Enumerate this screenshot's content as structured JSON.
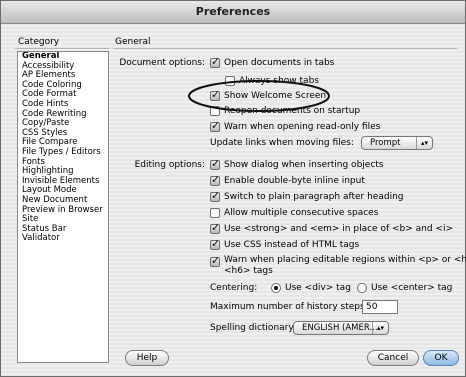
{
  "window": {
    "title": "Preferences"
  },
  "category": {
    "header": "Category",
    "items": [
      "General",
      "Accessibility",
      "AP Elements",
      "Code Coloring",
      "Code Format",
      "Code Hints",
      "Code Rewriting",
      "Copy/Paste",
      "CSS Styles",
      "File Compare",
      "File Types / Editors",
      "Fonts",
      "Highlighting",
      "Invisible Elements",
      "Layout Mode",
      "New Document",
      "Preview in Browser",
      "Site",
      "Status Bar",
      "Validator"
    ],
    "selected": "General"
  },
  "panel": {
    "header": "General"
  },
  "document_options": {
    "label": "Document options:",
    "open_in_tabs": {
      "label": "Open documents in tabs",
      "checked": true
    },
    "always_show_tabs": {
      "label": "Always show tabs",
      "checked": false
    },
    "show_welcome": {
      "label": "Show Welcome Screen",
      "checked": true
    },
    "reopen_docs": {
      "label": "Reopen documents on startup",
      "checked": false
    },
    "warn_readonly": {
      "label": "Warn when opening read-only files",
      "checked": true
    },
    "update_links": {
      "label": "Update links when moving files:",
      "value": "Prompt"
    }
  },
  "editing_options": {
    "label": "Editing options:",
    "items": [
      {
        "label": "Show dialog when inserting objects",
        "checked": true
      },
      {
        "label": "Enable double-byte inline input",
        "checked": true
      },
      {
        "label": "Switch to plain paragraph after heading",
        "checked": true
      },
      {
        "label": "Allow multiple consecutive spaces",
        "checked": false
      },
      {
        "label": "Use <strong> and <em> in place of <b> and <i>",
        "checked": true
      },
      {
        "label": "Use CSS instead of HTML tags",
        "checked": true
      },
      {
        "label": "Warn when placing editable regions within <p> or <h1>",
        "label2": "<h6> tags",
        "checked": true
      }
    ]
  },
  "centering": {
    "label": "Centering:",
    "div_option": "Use <div> tag",
    "center_option": "Use <center> tag",
    "selected": "div"
  },
  "history": {
    "label": "Maximum number of history steps:",
    "value": "50"
  },
  "spelling": {
    "label": "Spelling dictionary:",
    "value": "ENGLISH (AMER..."
  },
  "buttons": {
    "help": "Help",
    "cancel": "Cancel",
    "ok": "OK"
  }
}
